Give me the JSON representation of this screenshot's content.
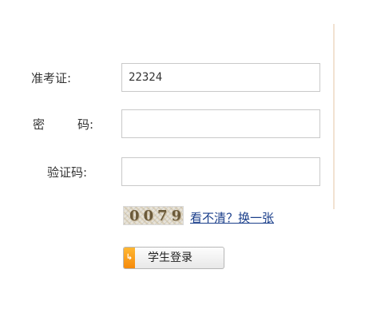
{
  "form": {
    "ticket": {
      "label": "准考证:",
      "value": "22324"
    },
    "password": {
      "label_left": "密",
      "label_right": "码:",
      "value": ""
    },
    "captcha": {
      "label": "验证码:",
      "value": ""
    }
  },
  "captcha_image": {
    "text": "0079"
  },
  "refresh_link": {
    "label": "看不清？换一张"
  },
  "login_button": {
    "label": "学生登录",
    "icon": "arrow-icon"
  },
  "colors": {
    "link": "#1b3f8b",
    "button_icon": "#f58a0b",
    "border": "#c9c9c9"
  }
}
